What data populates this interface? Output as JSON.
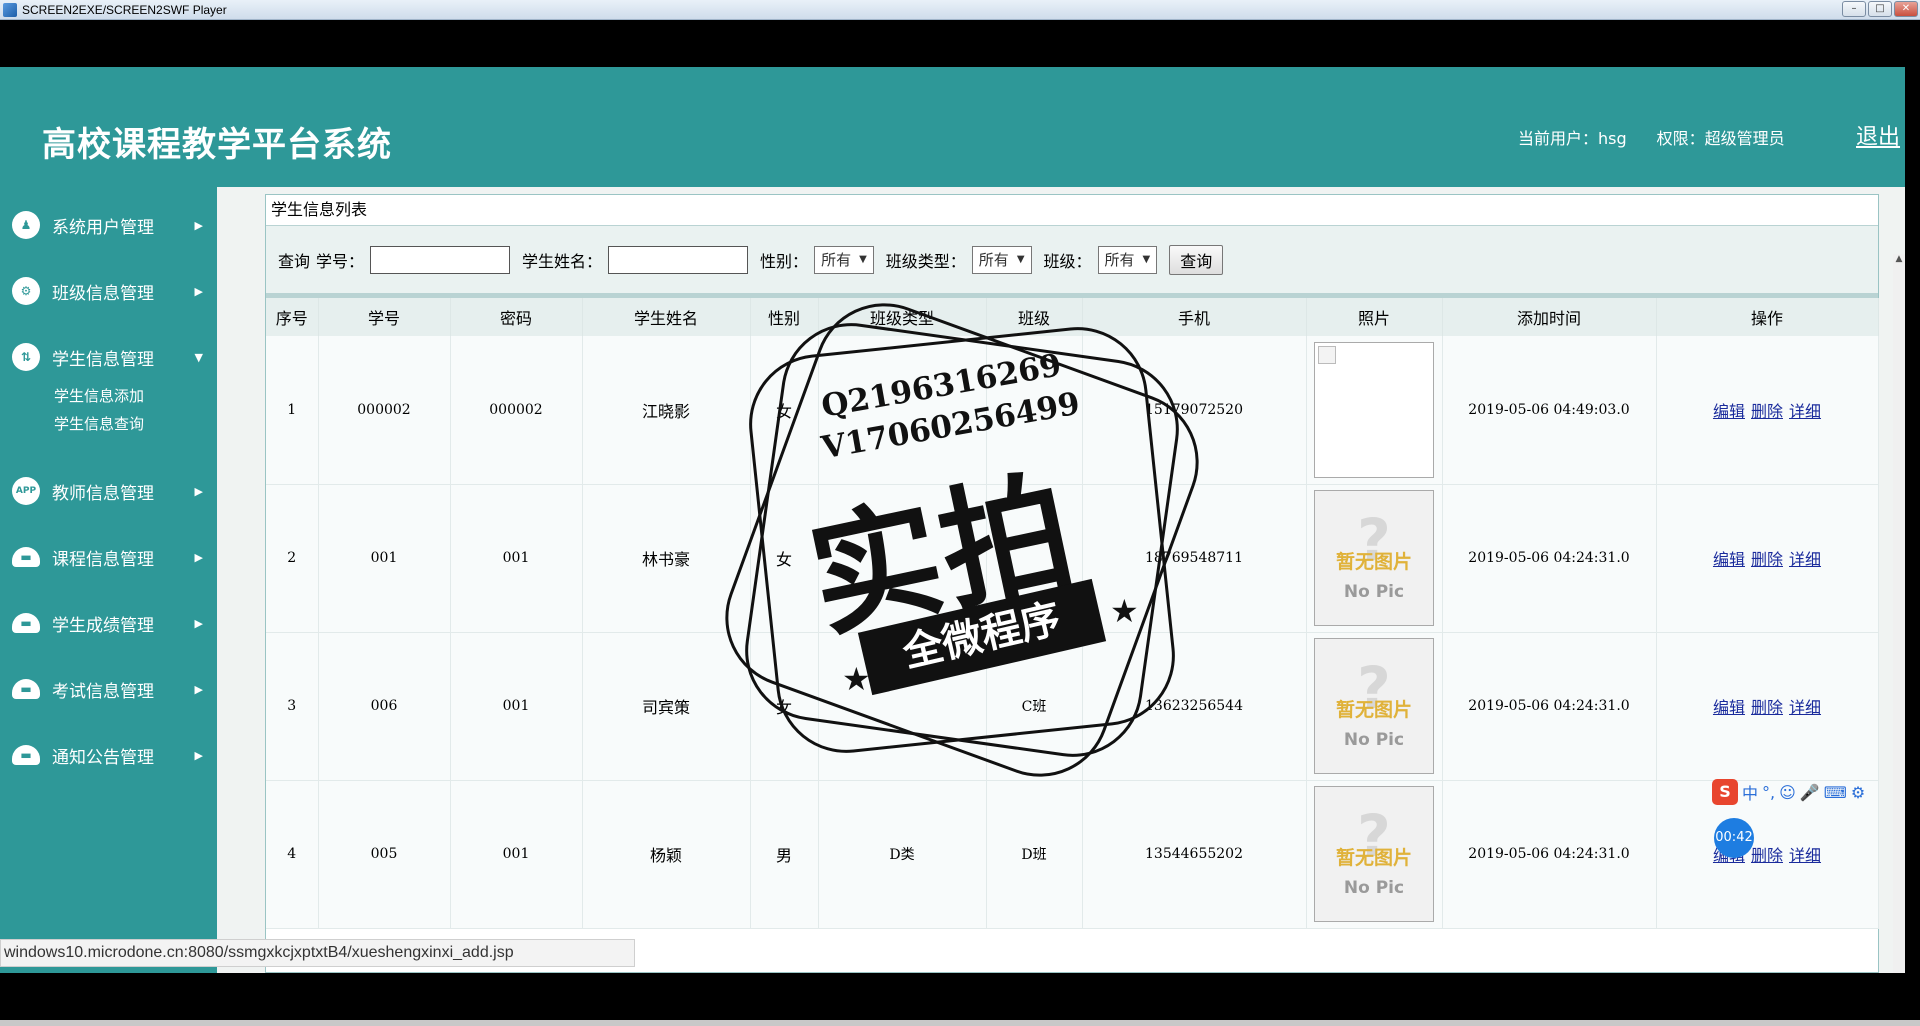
{
  "player": {
    "title": "SCREEN2EXE/SCREEN2SWF Player",
    "minimize": "–",
    "restore": "□",
    "close": "✕"
  },
  "header": {
    "brand": "高校课程教学平台系统",
    "current_user": "当前用户：hsg",
    "permission": "权限：超级管理员",
    "logout": "退出"
  },
  "sidebar": {
    "items": [
      {
        "label": "系统用户管理",
        "icon": "user-badge-icon",
        "glyph": "♟",
        "arrow": "▶"
      },
      {
        "label": "班级信息管理",
        "icon": "user-gear-icon",
        "glyph": "⚙",
        "arrow": "▶"
      },
      {
        "label": "学生信息管理",
        "icon": "swap-icon",
        "glyph": "⇅",
        "arrow": "▼"
      },
      {
        "label": "教师信息管理",
        "icon": "app-icon",
        "glyph": "APP",
        "arrow": "▶"
      },
      {
        "label": "课程信息管理",
        "icon": "cloud-icon",
        "glyph": "▬",
        "arrow": "▶"
      },
      {
        "label": "学生成绩管理",
        "icon": "cloud-icon",
        "glyph": "▬",
        "arrow": "▶"
      },
      {
        "label": "考试信息管理",
        "icon": "cloud-icon",
        "glyph": "▬",
        "arrow": "▶"
      },
      {
        "label": "通知公告管理",
        "icon": "cloud-icon",
        "glyph": "▬",
        "arrow": "▶"
      }
    ],
    "sub_items": [
      "学生信息添加",
      "学生信息查询"
    ]
  },
  "panel": {
    "title": "学生信息列表"
  },
  "search": {
    "query_label": "查询",
    "student_no_label": "学号：",
    "student_no_value": "",
    "student_name_label": "学生姓名：",
    "student_name_value": "",
    "sex_label": "性别：",
    "sex_value": "所有",
    "class_type_label": "班级类型：",
    "class_type_value": "所有",
    "class_label": "班级：",
    "class_value": "所有",
    "button": "查询"
  },
  "table": {
    "columns": [
      "序号",
      "学号",
      "密码",
      "学生姓名",
      "性别",
      "班级类型",
      "班级",
      "手机",
      "照片",
      "添加时间",
      "操作"
    ],
    "rows": [
      {
        "no": "1",
        "student_no": "000002",
        "password": "000002",
        "name": "江晓影",
        "sex": "女",
        "class_type": "",
        "class": "",
        "phone": "15179072520",
        "photo": "broken",
        "added": "2019-05-06 04:49:03.0"
      },
      {
        "no": "2",
        "student_no": "001",
        "password": "001",
        "name": "林书豪",
        "sex": "女",
        "class_type": "",
        "class": "",
        "phone": "18769548711",
        "photo": "nopic",
        "added": "2019-05-06 04:24:31.0"
      },
      {
        "no": "3",
        "student_no": "006",
        "password": "001",
        "name": "司宾策",
        "sex": "女",
        "class_type": "",
        "class": "C班",
        "phone": "13623256544",
        "photo": "nopic",
        "added": "2019-05-06 04:24:31.0"
      },
      {
        "no": "4",
        "student_no": "005",
        "password": "001",
        "name": "杨颖",
        "sex": "男",
        "class_type": "D类",
        "class": "D班",
        "phone": "13544655202",
        "photo": "nopic",
        "added": "2019-05-06 04:24:31.0"
      }
    ],
    "actions": {
      "edit": "编辑",
      "delete": "删除",
      "detail": "详细"
    },
    "nopic": {
      "q": "?",
      "cn": "暂无图片",
      "en": "No Pic"
    }
  },
  "status_bar": "windows10.microdone.cn:8080/ssmgxkcjxptxtB4/xueshengxinxi_add.jsp",
  "watermark": {
    "line1": "Q2196316269",
    "line2": "V17060256499",
    "big": "实拍",
    "banner": "全微程序",
    "star": "★"
  },
  "ime": {
    "logo": "S",
    "mode": "中",
    "punct": "°,"
  },
  "timer": "00:42"
}
